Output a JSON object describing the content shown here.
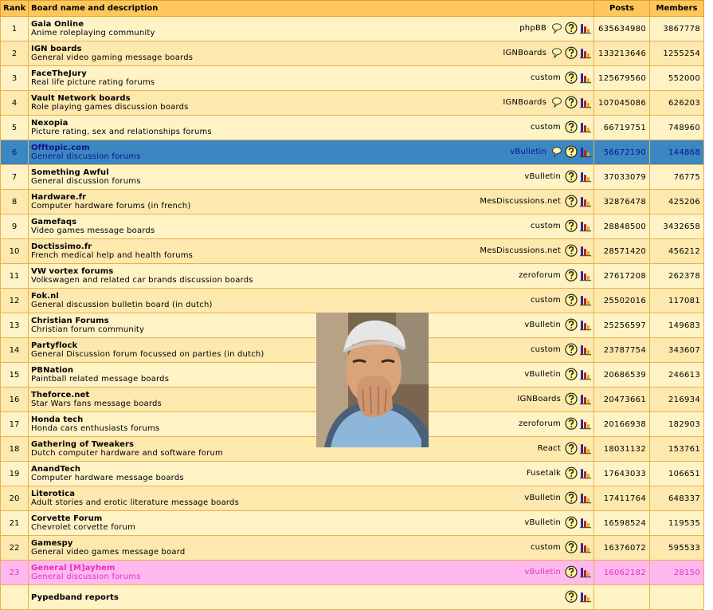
{
  "headers": {
    "rank": "Rank",
    "name": "Board name and description",
    "posts": "Posts",
    "members": "Members"
  },
  "rows": [
    {
      "rank": "1",
      "title": "Gaia Online",
      "desc": "Anime roleplaying community",
      "software": "phpBB",
      "chat": true,
      "posts": "635634980",
      "members": "3867778",
      "style": "a"
    },
    {
      "rank": "2",
      "title": "IGN boards",
      "desc": "General video gaming message boards",
      "software": "IGNBoards",
      "chat": true,
      "posts": "133213646",
      "members": "1255254",
      "style": "b"
    },
    {
      "rank": "3",
      "title": "FaceTheJury",
      "desc": "Real life picture rating forums",
      "software": "custom",
      "chat": false,
      "posts": "125679560",
      "members": "552000",
      "style": "a"
    },
    {
      "rank": "4",
      "title": "Vault Network boards",
      "desc": "Role playing games discussion boards",
      "software": "IGNBoards",
      "chat": true,
      "posts": "107045086",
      "members": "626203",
      "style": "b"
    },
    {
      "rank": "5",
      "title": "Nexopia",
      "desc": "Picture rating, sex and relationships forums",
      "software": "custom",
      "chat": false,
      "posts": "66719751",
      "members": "748960",
      "style": "a"
    },
    {
      "rank": "6",
      "title": "Offtopic.com",
      "desc": "General discussion forums",
      "software": "vBulletin",
      "chat": true,
      "posts": "56672190",
      "members": "144868",
      "style": "hl"
    },
    {
      "rank": "7",
      "title": "Something Awful",
      "desc": "General discussion forums",
      "software": "vBulletin",
      "chat": false,
      "posts": "37033079",
      "members": "76775",
      "style": "a"
    },
    {
      "rank": "8",
      "title": "Hardware.fr",
      "desc": "Computer hardware forums (in french)",
      "software": "MesDiscussions.net",
      "chat": false,
      "posts": "32876478",
      "members": "425206",
      "style": "b"
    },
    {
      "rank": "9",
      "title": "Gamefaqs",
      "desc": "Video games message boards",
      "software": "custom",
      "chat": false,
      "posts": "28848500",
      "members": "3432658",
      "style": "a"
    },
    {
      "rank": "10",
      "title": "Doctissimo.fr",
      "desc": "French medical help and health forums",
      "software": "MesDiscussions.net",
      "chat": false,
      "posts": "28571420",
      "members": "456212",
      "style": "b"
    },
    {
      "rank": "11",
      "title": "VW vortex forums",
      "desc": "Volkswagen and related car brands discussion boards",
      "software": "zeroforum",
      "chat": false,
      "posts": "27617208",
      "members": "262378",
      "style": "a"
    },
    {
      "rank": "12",
      "title": "Fok.nl",
      "desc": "General discussion bulletin board (in dutch)",
      "software": "custom",
      "chat": false,
      "posts": "25502016",
      "members": "117081",
      "style": "b"
    },
    {
      "rank": "13",
      "title": "Christian Forums",
      "desc": "Christian forum community",
      "software": "vBulletin",
      "chat": false,
      "posts": "25256597",
      "members": "149683",
      "style": "a"
    },
    {
      "rank": "14",
      "title": "Partyflock",
      "desc": "General Discussion forum focussed on parties (in dutch)",
      "software": "custom",
      "chat": false,
      "posts": "23787754",
      "members": "343607",
      "style": "b"
    },
    {
      "rank": "15",
      "title": "PBNation",
      "desc": "Paintball related message boards",
      "software": "vBulletin",
      "chat": false,
      "posts": "20686539",
      "members": "246613",
      "style": "a"
    },
    {
      "rank": "16",
      "title": "Theforce.net",
      "desc": "Star Wars fans message boards",
      "software": "IGNBoards",
      "chat": false,
      "posts": "20473661",
      "members": "216934",
      "style": "b"
    },
    {
      "rank": "17",
      "title": "Honda tech",
      "desc": "Honda cars enthusiasts forums",
      "software": "zeroforum",
      "chat": false,
      "posts": "20166938",
      "members": "182903",
      "style": "a"
    },
    {
      "rank": "18",
      "title": "Gathering of Tweakers",
      "desc": "Dutch computer hardware and software forum",
      "software": "React",
      "chat": false,
      "posts": "18031132",
      "members": "153761",
      "style": "b"
    },
    {
      "rank": "19",
      "title": "AnandTech",
      "desc": "Computer hardware message boards",
      "software": "Fusetalk",
      "chat": false,
      "posts": "17643033",
      "members": "106651",
      "style": "a"
    },
    {
      "rank": "20",
      "title": "Literotica",
      "desc": "Adult stories and erotic literature message boards",
      "software": "vBulletin",
      "chat": false,
      "posts": "17411764",
      "members": "648337",
      "style": "b"
    },
    {
      "rank": "21",
      "title": "Corvette Forum",
      "desc": "Chevrolet corvette forum",
      "software": "vBulletin",
      "chat": false,
      "posts": "16598524",
      "members": "119535",
      "style": "a"
    },
    {
      "rank": "22",
      "title": "Gamespy",
      "desc": "General video games message board",
      "software": "custom",
      "chat": false,
      "posts": "16376072",
      "members": "595533",
      "style": "b"
    },
    {
      "rank": "23",
      "title": "General [M]ayhem",
      "desc": "General discussion forums",
      "software": "vBulletin",
      "chat": false,
      "posts": "16062182",
      "members": "28150",
      "style": "pink"
    },
    {
      "rank": "",
      "title": "Pypedband reports",
      "desc": "",
      "software": "",
      "chat": false,
      "posts": "",
      "members": "",
      "style": "a"
    }
  ],
  "icons": {
    "chat": "speech-bubble-icon",
    "help": "question-mark-icon",
    "stats": "bar-chart-icon"
  },
  "colors": {
    "header": "#fdc75b",
    "row_light": "#fff3c6",
    "row_dark": "#fde8ae",
    "highlight": "#3a87c2",
    "pink": "#ffb9ef"
  }
}
